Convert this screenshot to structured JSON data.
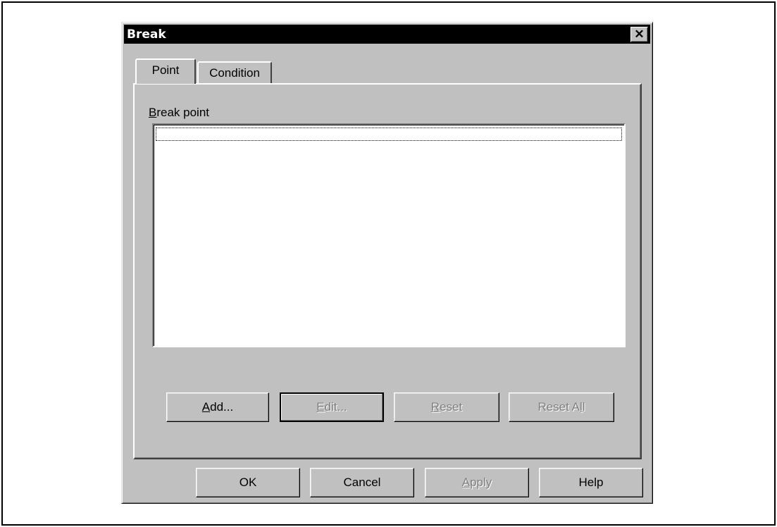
{
  "dialog": {
    "title": "Break",
    "close_glyph": "✕"
  },
  "tabs": [
    {
      "label": "Point",
      "active": true
    },
    {
      "label": "Condition",
      "active": false
    }
  ],
  "point_tab": {
    "group_label_mnemonic": "B",
    "group_label_rest": "reak point",
    "break_points": [],
    "buttons": [
      {
        "mnemonic": "A",
        "rest": "dd...",
        "enabled": true
      },
      {
        "mnemonic": "E",
        "rest": "dit...",
        "enabled": false
      },
      {
        "mnemonic": "R",
        "rest": "eset",
        "enabled": false
      },
      {
        "pre": "Reset A",
        "mnemonic": "l",
        "rest": "l",
        "enabled": false
      }
    ]
  },
  "footer_buttons": {
    "ok": "OK",
    "cancel": "Cancel",
    "apply_mnemonic": "A",
    "apply_rest": "pply",
    "help": "Help"
  },
  "colors": {
    "face": "#c0c0c0",
    "titlebar": "#000000",
    "disabled_text": "#808080"
  },
  "icons": {
    "close": "close-icon"
  }
}
